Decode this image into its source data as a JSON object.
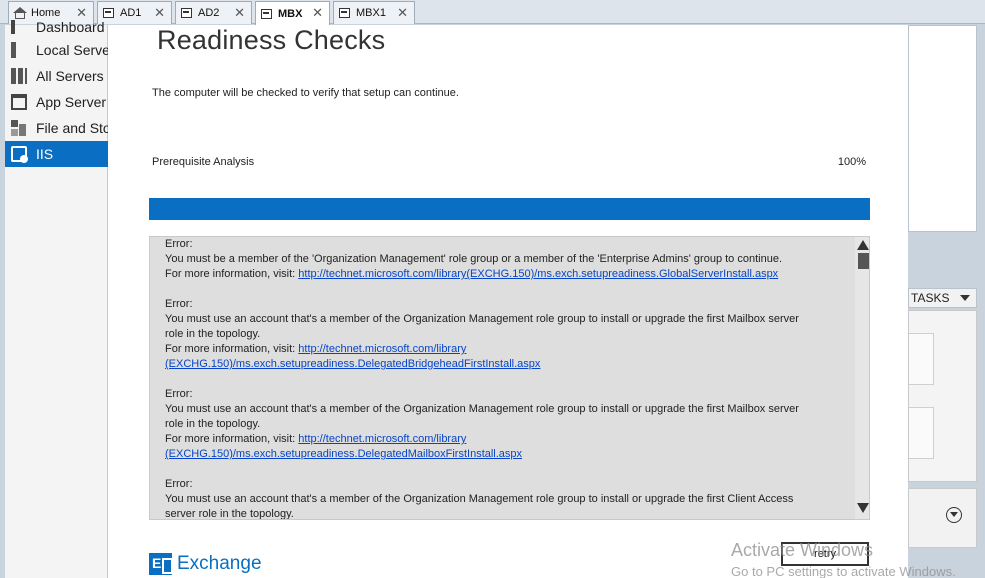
{
  "tabs": [
    {
      "label": "Home",
      "icon": "home-icon",
      "active": false
    },
    {
      "label": "AD1",
      "icon": "server-icon",
      "active": false
    },
    {
      "label": "AD2",
      "icon": "server-icon",
      "active": false
    },
    {
      "label": "MBX",
      "icon": "server-icon",
      "active": true
    },
    {
      "label": "MBX1",
      "icon": "server-icon",
      "active": false
    }
  ],
  "sidebar": {
    "items": [
      {
        "label": "Dashboard",
        "icon": "dashboard-icon"
      },
      {
        "label": "Local Server",
        "icon": "local-server-icon"
      },
      {
        "label": "All Servers",
        "icon": "all-servers-icon"
      },
      {
        "label": "App Server",
        "icon": "app-server-icon"
      },
      {
        "label": "File and Storage Services",
        "icon": "file-storage-icon"
      },
      {
        "label": "IIS",
        "icon": "iis-icon",
        "active": true
      }
    ]
  },
  "wizard": {
    "title": "Readiness Checks",
    "subtitle": "The computer will be checked to verify that setup can continue.",
    "prereq_label": "Prerequisite Analysis",
    "prereq_percent_text": "100%",
    "progress_fraction": 1.0,
    "errors": [
      {
        "heading": "Error:",
        "lines": [
          "You must be a member of the 'Organization Management' role group or a member of the 'Enterprise Admins' group to continue."
        ],
        "info_prefix": "For more information, visit: ",
        "link_lines": [
          "http://technet.microsoft.com/library(EXCHG.150)/ms.exch.setupreadiness.GlobalServerInstall.aspx"
        ]
      },
      {
        "heading": "Error:",
        "lines": [
          "You must use an account that's a member of the Organization Management role group to install or upgrade the first Mailbox server",
          "role in the topology."
        ],
        "info_prefix": "For more information, visit: ",
        "link_lines": [
          "http://technet.microsoft.com/library",
          "(EXCHG.150)/ms.exch.setupreadiness.DelegatedBridgeheadFirstInstall.aspx"
        ]
      },
      {
        "heading": "Error:",
        "lines": [
          "You must use an account that's a member of the Organization Management role group to install or upgrade the first Mailbox server",
          "role in the topology."
        ],
        "info_prefix": "For more information, visit: ",
        "link_lines": [
          "http://technet.microsoft.com/library",
          "(EXCHG.150)/ms.exch.setupreadiness.DelegatedMailboxFirstInstall.aspx"
        ]
      },
      {
        "heading": "Error:",
        "lines": [
          "You must use an account that's a member of the Organization Management role group to install or upgrade the first Client Access",
          "server role in the topology."
        ],
        "info_prefix": "",
        "link_lines": []
      }
    ],
    "logo_text": "Exchange",
    "retry_label": "retry"
  },
  "right_panel": {
    "tasks_label": "TASKS"
  },
  "watermark": {
    "line1": "Activate Windows",
    "line2": "Go to PC settings to activate Windows."
  },
  "colors": {
    "accent": "#0a6fc2",
    "link": "#0645c8",
    "error_panel_bg": "#dedede"
  }
}
